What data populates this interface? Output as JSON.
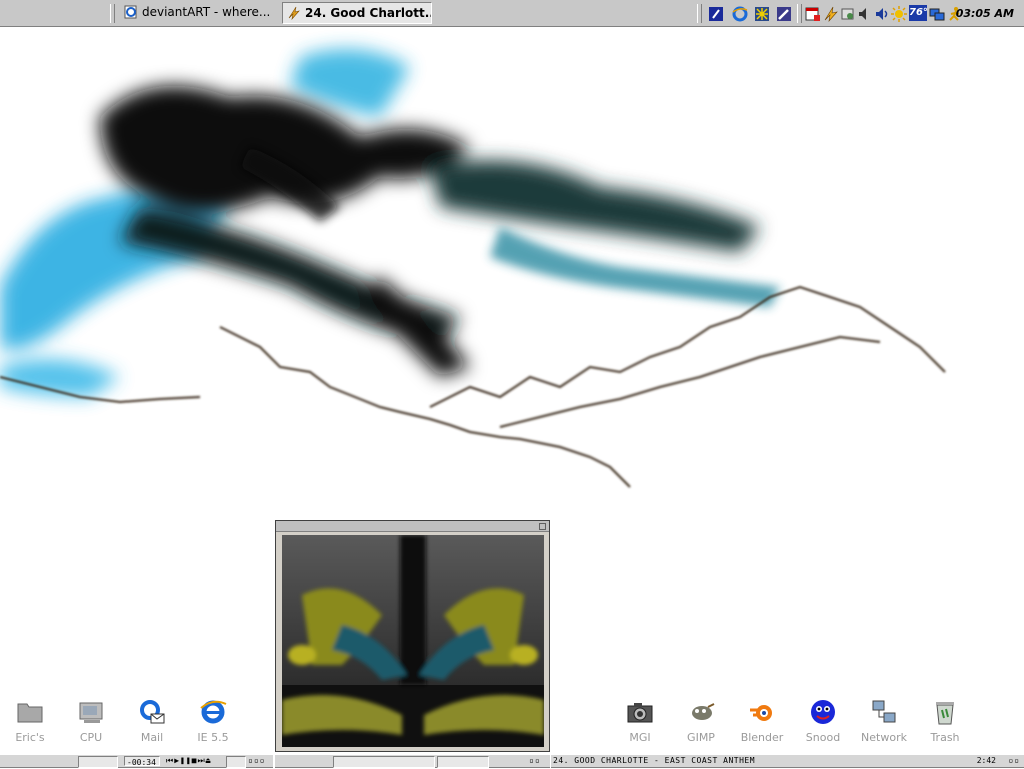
{
  "taskbar": {
    "tasks": [
      {
        "label": "deviantART - where...",
        "icon": "ie-page-icon"
      },
      {
        "label": "24. Good Charlott...",
        "icon": "winamp-lightning-icon"
      }
    ],
    "tray_icons": [
      "shield-icon",
      "ie-icon",
      "network-star-icon",
      "pencil-icon",
      "calendar-icon",
      "lightning-icon",
      "tools-icon",
      "speaker-icon",
      "volume-icon",
      "sun-icon",
      "temperature-badge-icon",
      "monitor-icon",
      "running-man-icon"
    ],
    "temperature": "76°",
    "clock": "03:05 AM"
  },
  "desktop": {
    "left_icons": [
      {
        "label": "Eric's",
        "icon": "folder-icon"
      },
      {
        "label": "CPU",
        "icon": "computer-icon"
      },
      {
        "label": "Mail",
        "icon": "mail-icon"
      },
      {
        "label": "IE 5.5",
        "icon": "ie-icon"
      }
    ],
    "right_icons": [
      {
        "label": "MGI",
        "icon": "camera-icon"
      },
      {
        "label": "GIMP",
        "icon": "gimp-icon"
      },
      {
        "label": "Blender",
        "icon": "blender-icon"
      },
      {
        "label": "Snood",
        "icon": "snood-icon"
      },
      {
        "label": "Network",
        "icon": "network-icon"
      },
      {
        "label": "Trash",
        "icon": "trash-icon"
      }
    ]
  },
  "player": {
    "time_remaining": "-00:34",
    "track_title": "24. GOOD CHARLOTTE - EAST COAST ANTHEM",
    "track_time": "2:42"
  },
  "colors": {
    "accent": "#0a84c8",
    "taskbar": "#c8c8c8",
    "label": "#9a9a9a"
  }
}
